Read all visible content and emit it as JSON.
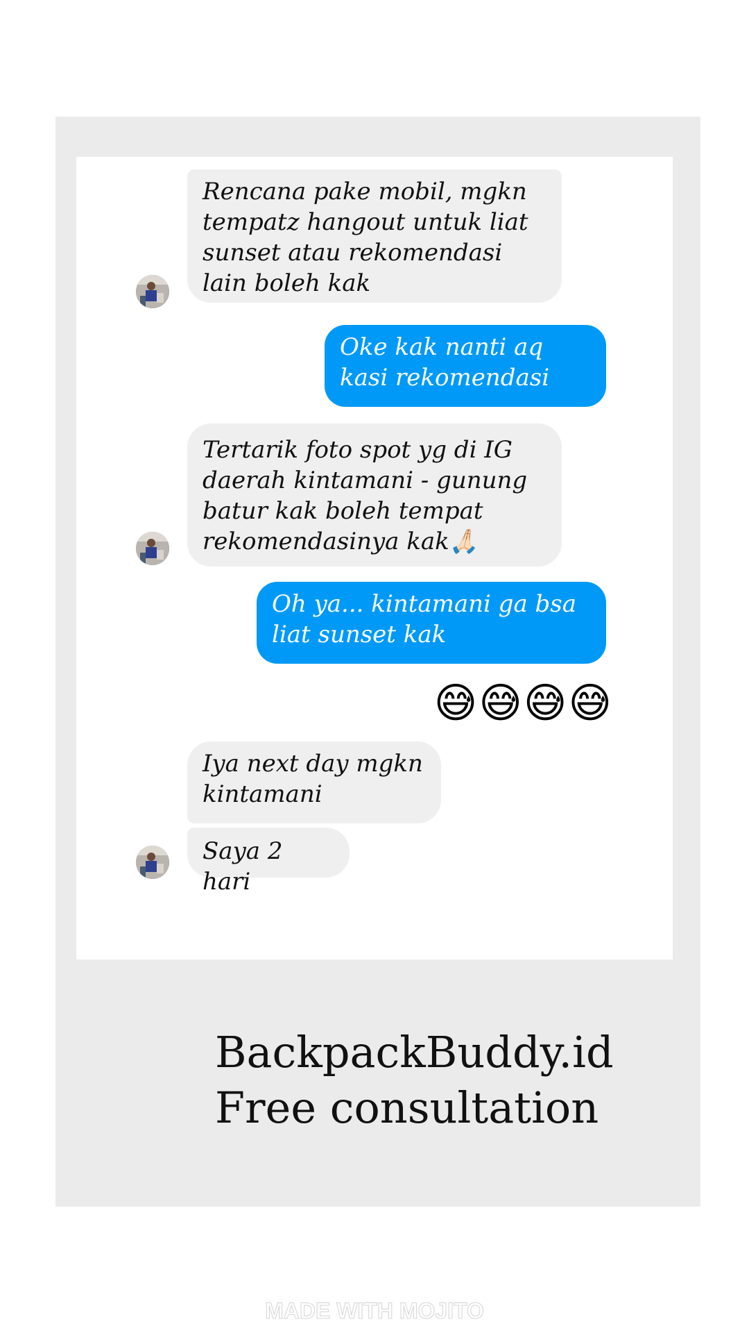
{
  "conversation": {
    "messages": [
      {
        "from": "customer",
        "text": "Rencana pake mobil, mgkn tempatz hangout untuk liat sunset atau rekomendasi lain boleh kak"
      },
      {
        "from": "agent",
        "text": "Oke kak nanti aq kasi rekomendasi"
      },
      {
        "from": "customer",
        "text": "Tertarik foto spot yg di IG daerah kintamani - gunung batur kak boleh tempat rekomendasinya kak🙏🏻"
      },
      {
        "from": "agent",
        "text": "Oh ya... kintamani ga bsa liat sunset kak"
      },
      {
        "from": "agent",
        "text": "😅😅😅😅"
      },
      {
        "from": "customer",
        "text": "Iya next day mgkn kintamani"
      },
      {
        "from": "customer",
        "text": "Saya 2 hari"
      }
    ]
  },
  "brand": {
    "name": "BackpackBuddy.id",
    "tagline": "Free consultation"
  },
  "watermark": "MADE WITH MOJITO",
  "colors": {
    "outgoing_bubble": "#0099f7",
    "incoming_bubble": "#efefef",
    "frame": "#ebebeb"
  },
  "icons": {
    "avatar": "customer-profile-photo"
  }
}
